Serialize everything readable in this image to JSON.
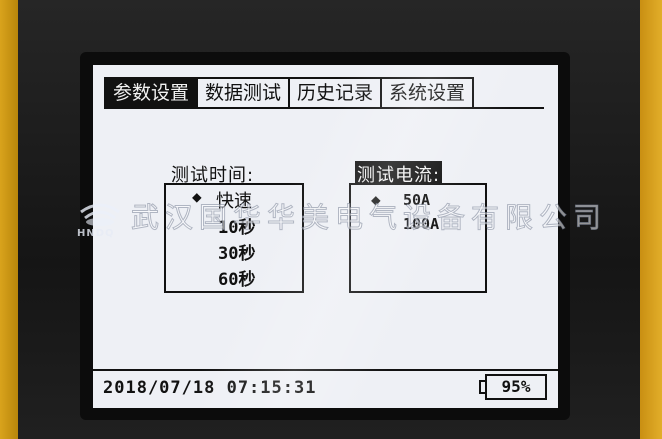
{
  "tabs": [
    {
      "label": "参数设置",
      "active": true
    },
    {
      "label": "数据测试",
      "active": false
    },
    {
      "label": "历史记录",
      "active": false
    },
    {
      "label": "系统设置",
      "active": false
    }
  ],
  "test_time": {
    "label": "测试时间:",
    "options": [
      "快速",
      "10秒",
      "30秒",
      "60秒"
    ],
    "selected": "快速"
  },
  "test_current": {
    "label": "测试电流:",
    "options": [
      "50A",
      "100A"
    ],
    "selected": "50A"
  },
  "status": {
    "datetime": "2018/07/18 07:15:31",
    "battery": "95%"
  },
  "watermark": {
    "company": "武汉国华华美电气设备有限公司",
    "logo_text": "HNDQ"
  },
  "colors": {
    "lcd_background": "#eef0f5",
    "ink": "#111111",
    "housing_accent": "#d9a31c"
  }
}
